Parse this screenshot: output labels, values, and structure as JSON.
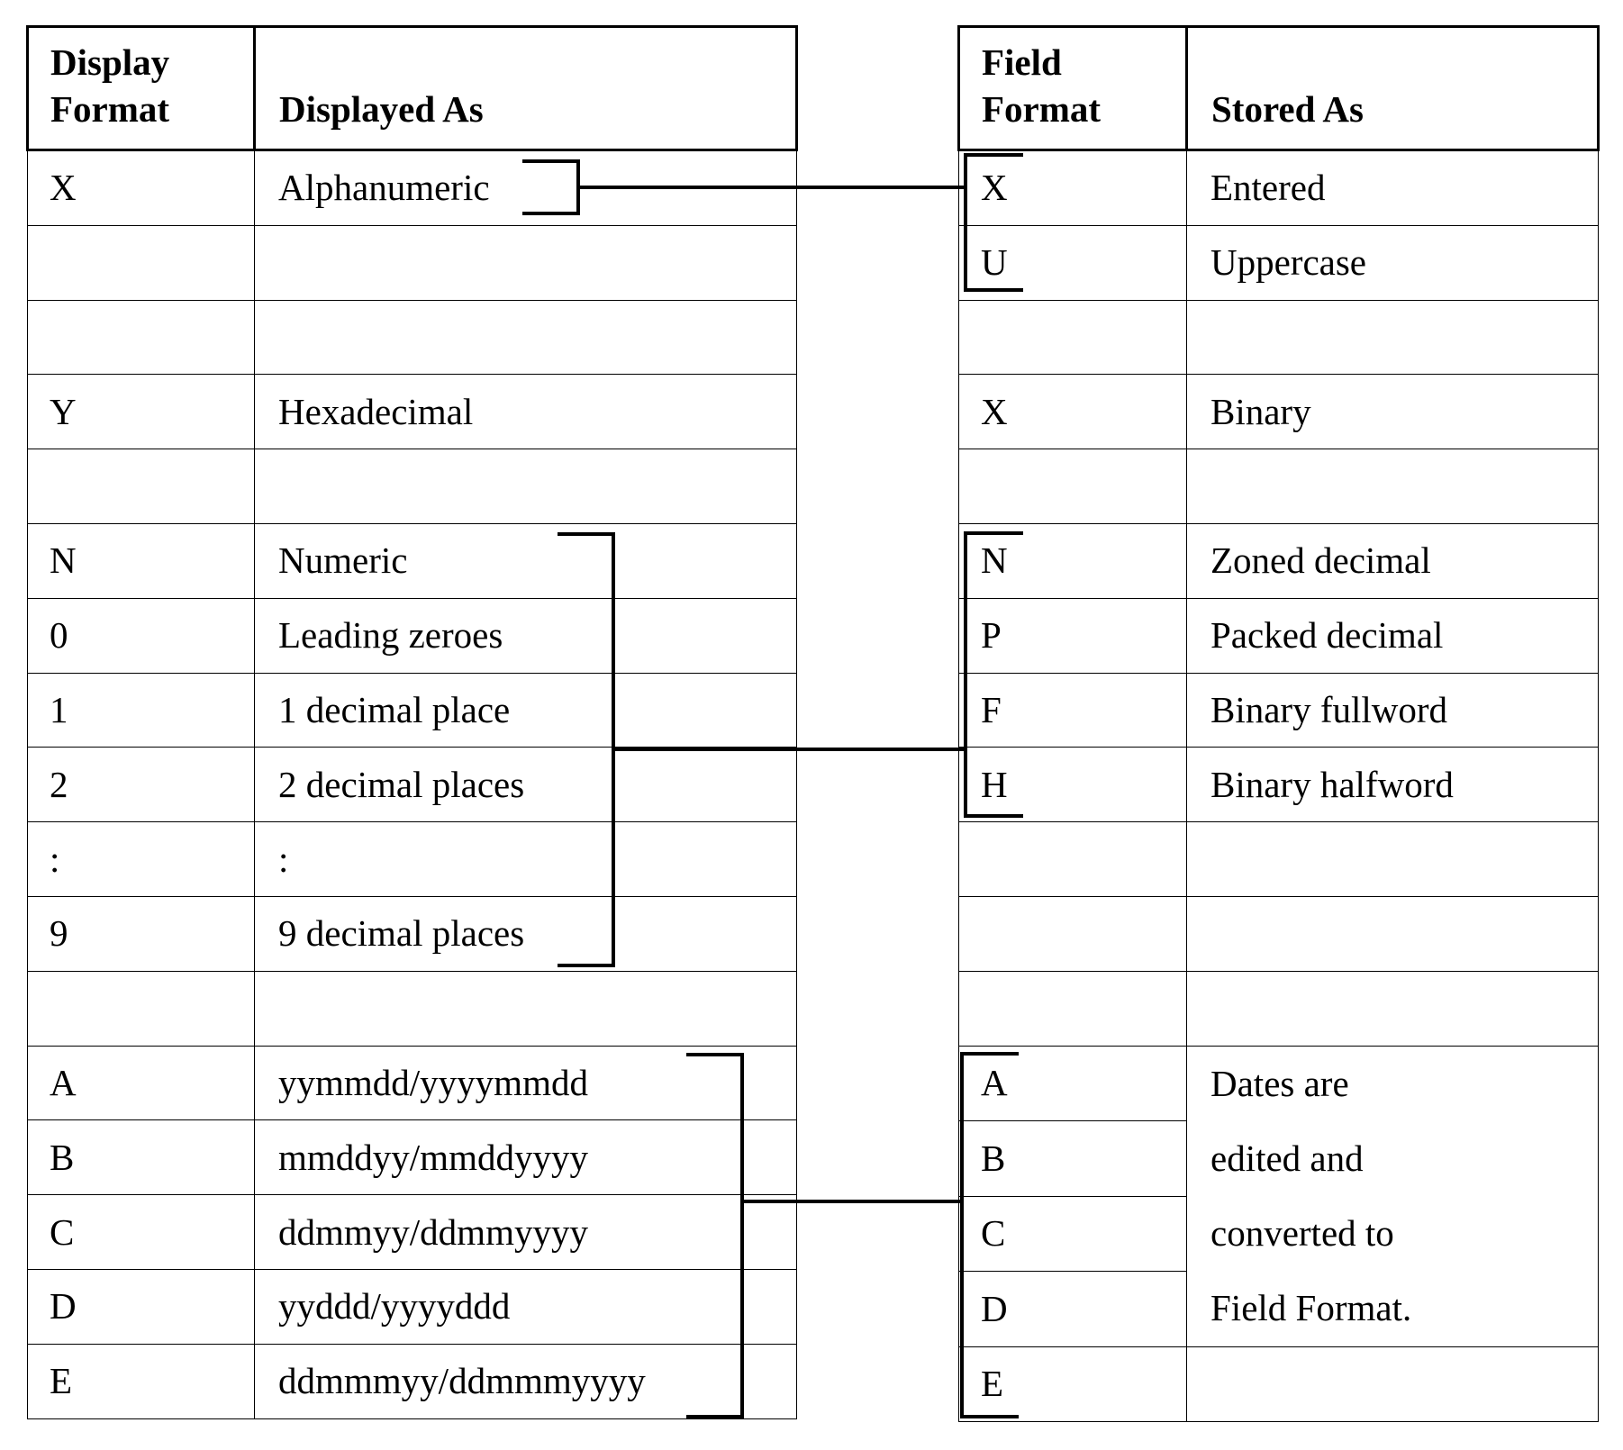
{
  "left_table": {
    "headers": {
      "format": [
        "Display",
        "Format"
      ],
      "meaning": "Displayed As"
    },
    "rows": [
      {
        "format": "X",
        "meaning": "Alphanumeric"
      },
      {
        "format": "",
        "meaning": ""
      },
      {
        "format": "",
        "meaning": ""
      },
      {
        "format": "Y",
        "meaning": "Hexadecimal"
      },
      {
        "format": "",
        "meaning": ""
      },
      {
        "format": "N",
        "meaning": "Numeric"
      },
      {
        "format": "0",
        "meaning": "Leading zeroes"
      },
      {
        "format": "1",
        "meaning": "1 decimal place"
      },
      {
        "format": "2",
        "meaning": "2 decimal places"
      },
      {
        "format": ":",
        "meaning": ":"
      },
      {
        "format": "9",
        "meaning": "9 decimal places"
      },
      {
        "format": "",
        "meaning": ""
      },
      {
        "format": "A",
        "meaning": "yymmdd/yyyymmdd"
      },
      {
        "format": "B",
        "meaning": "mmddyy/mmddyyyy"
      },
      {
        "format": "C",
        "meaning": "ddmmyy/ddmmyyyy"
      },
      {
        "format": "D",
        "meaning": "yyddd/yyyyddd"
      },
      {
        "format": "E",
        "meaning": "ddmmmyy/ddmmmyyyy"
      }
    ]
  },
  "right_table": {
    "headers": {
      "format": [
        "Field",
        "Format"
      ],
      "meaning": "Stored As"
    },
    "rows": [
      {
        "format": "X",
        "meaning": "Entered"
      },
      {
        "format": "U",
        "meaning": "Uppercase"
      },
      {
        "format": "",
        "meaning": ""
      },
      {
        "format": "X",
        "meaning": "Binary"
      },
      {
        "format": "",
        "meaning": ""
      },
      {
        "format": "N",
        "meaning": "Zoned decimal"
      },
      {
        "format": "P",
        "meaning": "Packed decimal"
      },
      {
        "format": "F",
        "meaning": "Binary fullword"
      },
      {
        "format": "H",
        "meaning": "Binary halfword"
      },
      {
        "format": "",
        "meaning": ""
      },
      {
        "format": "",
        "meaning": ""
      },
      {
        "format": "",
        "meaning": ""
      },
      {
        "format": "A"
      },
      {
        "format": "B"
      },
      {
        "format": "C"
      },
      {
        "format": "D"
      },
      {
        "format": "E",
        "meaning": ""
      }
    ],
    "date_note_lines": [
      "Dates are",
      "edited and",
      "converted to",
      "Field Format."
    ]
  },
  "connections": [
    {
      "from": "Display X (Alphanumeric)",
      "to": "Field X, U"
    },
    {
      "from": "Display N, 0-9 (Numeric)",
      "to": "Field N, P, F, H"
    },
    {
      "from": "Display A-E (Dates)",
      "to": "Field A-E"
    }
  ]
}
